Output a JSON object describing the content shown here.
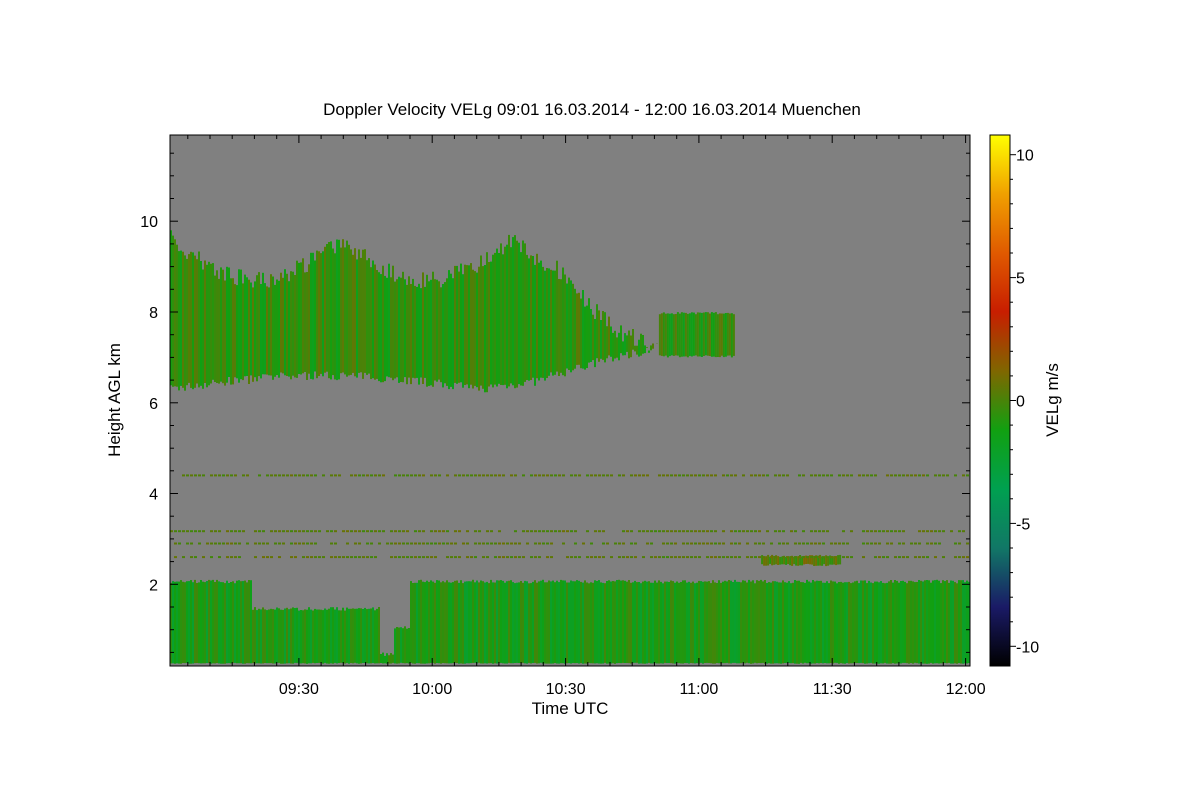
{
  "chart_data": {
    "type": "heatmap",
    "title": "Doppler Velocity VELg   09:01 16.03.2014 - 12:00 16.03.2014 Muenchen",
    "xlabel": "Time UTC",
    "ylabel": "Height AGL km",
    "colorbar_label": "VELg m/s",
    "x_unit": "UTC time",
    "xlim": [
      "09:01",
      "12:01"
    ],
    "x_ticks": [
      "09:30",
      "10:00",
      "10:30",
      "11:00",
      "11:30",
      "12:00"
    ],
    "ylim": [
      0.2,
      11.9
    ],
    "y_ticks": [
      2,
      4,
      6,
      8,
      10
    ],
    "colorbar_range": [
      -10.8,
      10.8
    ],
    "colorbar_ticks": [
      -10,
      -5,
      0,
      5,
      10
    ],
    "colormap": [
      "#000000",
      "#1a1a66",
      "#117766",
      "#00a050",
      "#11a011",
      "#806600",
      "#c81e00",
      "#e05a00",
      "#f0a000",
      "#ffff00"
    ],
    "background_color": "#808080",
    "regions": [
      {
        "name": "upper cloud layer",
        "t_start": "09:01",
        "t_end": "10:51",
        "z_bottom": 6.2,
        "z_top": 9.8,
        "mean_velocity": -0.6
      },
      {
        "name": "upper cloud tail",
        "t_start": "10:51",
        "t_end": "11:08",
        "z_bottom": 7.0,
        "z_top": 8.0,
        "mean_velocity": -0.5
      },
      {
        "name": "boundary layer",
        "t_start": "09:01",
        "t_end": "12:01",
        "z_bottom": 0.25,
        "z_top": 2.1,
        "mean_velocity": -1.2
      },
      {
        "name": "low cloud patch",
        "t_start": "11:14",
        "t_end": "11:32",
        "z_bottom": 2.4,
        "z_top": 2.65,
        "mean_velocity": 0.2
      }
    ],
    "bands": [
      {
        "name": "noise band",
        "z": 4.4,
        "mean_velocity": 0.3
      },
      {
        "name": "noise band",
        "z": 3.17,
        "mean_velocity": 0.3
      },
      {
        "name": "noise band",
        "z": 2.9,
        "mean_velocity": 0.3
      },
      {
        "name": "noise band",
        "z": 2.6,
        "mean_velocity": 0.3
      }
    ]
  }
}
